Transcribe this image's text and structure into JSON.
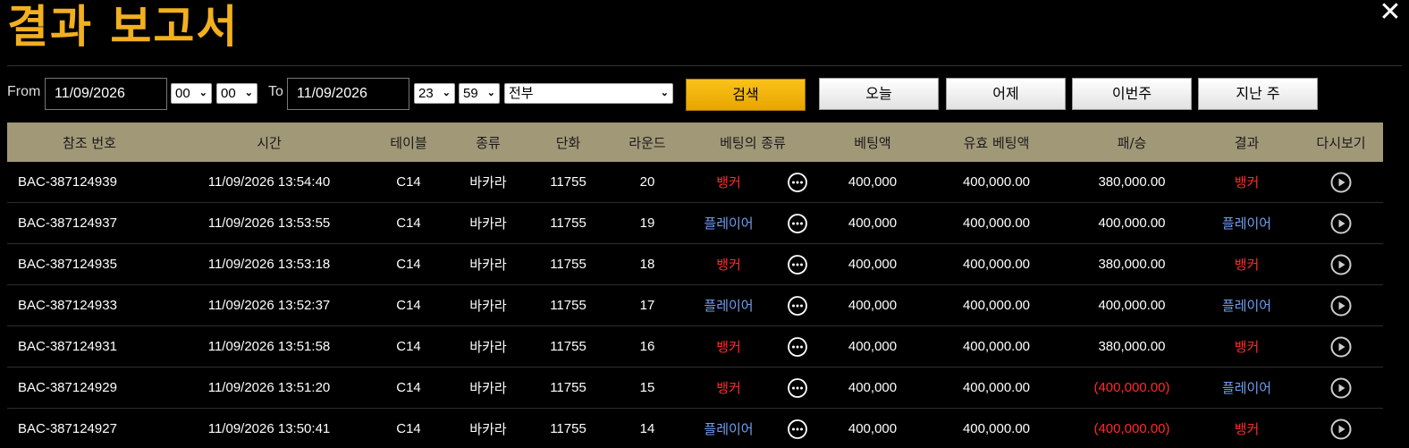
{
  "title": "결과 보고서",
  "close_label": "✕",
  "filters": {
    "from_label": "From",
    "from_date": "11/09/2026",
    "from_hour": "00",
    "from_min": "00",
    "to_label": "To",
    "to_date": "11/09/2026",
    "to_hour": "23",
    "to_min": "59",
    "type_select": "전부",
    "search_label": "검색",
    "today_label": "오늘",
    "yesterday_label": "어제",
    "this_week_label": "이번주",
    "last_week_label": "지난 주"
  },
  "table": {
    "headers": [
      "참조 번호",
      "시간",
      "테이블",
      "종류",
      "단화",
      "라운드",
      "베팅의 종류",
      "베팅액",
      "유효 베팅액",
      "패/승",
      "결과",
      "다시보기"
    ],
    "rows": [
      {
        "ref": "BAC-387124939",
        "time": "11/09/2026 13:54:40",
        "table": "C14",
        "game": "바카라",
        "shoe": "11755",
        "round": "20",
        "bet_type": "뱅커",
        "bet_color": "red",
        "amount": "400,000",
        "valid": "400,000.00",
        "win_loss": "380,000.00",
        "negative": false,
        "result": "뱅커",
        "result_color": "red"
      },
      {
        "ref": "BAC-387124937",
        "time": "11/09/2026 13:53:55",
        "table": "C14",
        "game": "바카라",
        "shoe": "11755",
        "round": "19",
        "bet_type": "플레이어",
        "bet_color": "blue",
        "amount": "400,000",
        "valid": "400,000.00",
        "win_loss": "400,000.00",
        "negative": false,
        "result": "플레이어",
        "result_color": "blue"
      },
      {
        "ref": "BAC-387124935",
        "time": "11/09/2026 13:53:18",
        "table": "C14",
        "game": "바카라",
        "shoe": "11755",
        "round": "18",
        "bet_type": "뱅커",
        "bet_color": "red",
        "amount": "400,000",
        "valid": "400,000.00",
        "win_loss": "380,000.00",
        "negative": false,
        "result": "뱅커",
        "result_color": "red"
      },
      {
        "ref": "BAC-387124933",
        "time": "11/09/2026 13:52:37",
        "table": "C14",
        "game": "바카라",
        "shoe": "11755",
        "round": "17",
        "bet_type": "플레이어",
        "bet_color": "blue",
        "amount": "400,000",
        "valid": "400,000.00",
        "win_loss": "400,000.00",
        "negative": false,
        "result": "플레이어",
        "result_color": "blue"
      },
      {
        "ref": "BAC-387124931",
        "time": "11/09/2026 13:51:58",
        "table": "C14",
        "game": "바카라",
        "shoe": "11755",
        "round": "16",
        "bet_type": "뱅커",
        "bet_color": "red",
        "amount": "400,000",
        "valid": "400,000.00",
        "win_loss": "380,000.00",
        "negative": false,
        "result": "뱅커",
        "result_color": "red"
      },
      {
        "ref": "BAC-387124929",
        "time": "11/09/2026 13:51:20",
        "table": "C14",
        "game": "바카라",
        "shoe": "11755",
        "round": "15",
        "bet_type": "뱅커",
        "bet_color": "red",
        "amount": "400,000",
        "valid": "400,000.00",
        "win_loss": "(400,000.00)",
        "negative": true,
        "result": "플레이어",
        "result_color": "blue"
      },
      {
        "ref": "BAC-387124927",
        "time": "11/09/2026 13:50:41",
        "table": "C14",
        "game": "바카라",
        "shoe": "11755",
        "round": "14",
        "bet_type": "플레이어",
        "bet_color": "blue",
        "amount": "400,000",
        "valid": "400,000.00",
        "win_loss": "(400,000.00)",
        "negative": true,
        "result": "뱅커",
        "result_color": "red"
      }
    ]
  },
  "icons": {
    "details": "more-dots-icon",
    "replay": "play-circle-icon",
    "close": "close-icon"
  }
}
